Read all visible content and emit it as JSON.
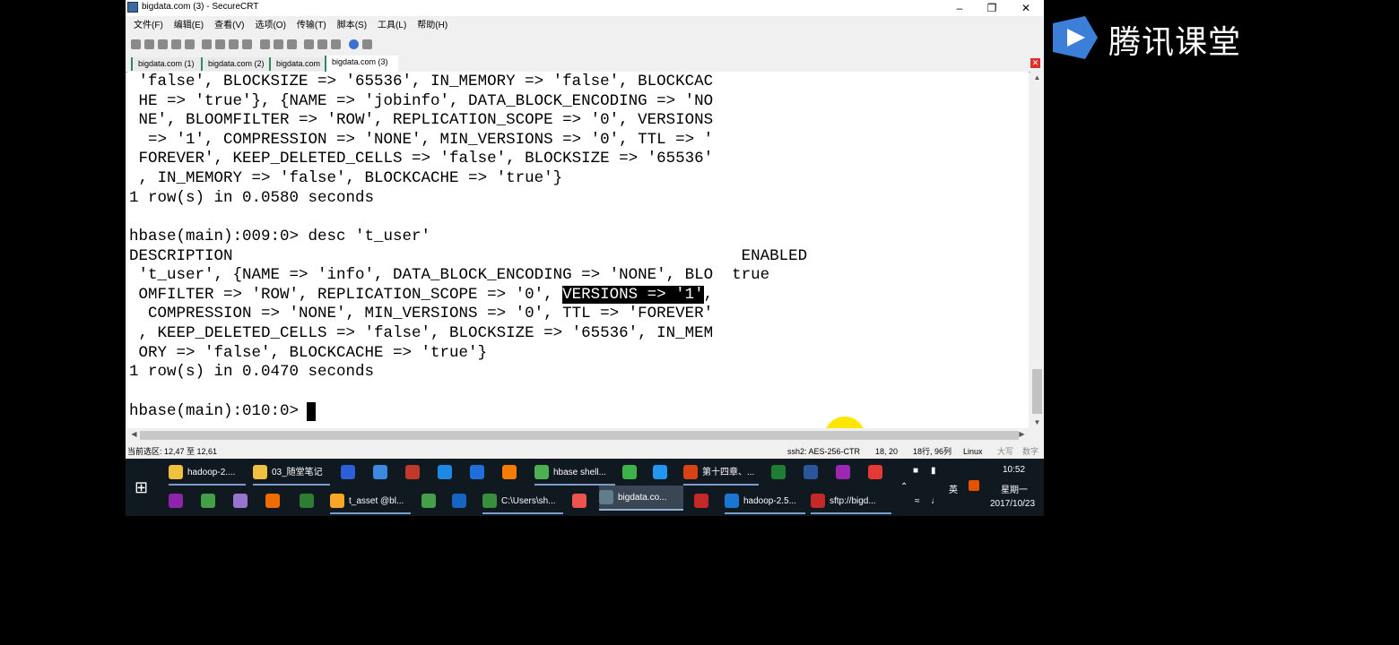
{
  "window": {
    "title": "bigdata.com (3) - SecureCRT"
  },
  "menu": [
    "文件(F)",
    "编辑(E)",
    "查看(V)",
    "选项(O)",
    "传输(T)",
    "脚本(S)",
    "工具(L)",
    "帮助(H)"
  ],
  "tabs": [
    {
      "label": "bigdata.com (1)"
    },
    {
      "label": "bigdata.com (2)"
    },
    {
      "label": "bigdata.com"
    },
    {
      "label": "bigdata.com (3)"
    }
  ],
  "terminal": {
    "lines": [
      " 'false', BLOCKSIZE => '65536', IN_MEMORY => 'false', BLOCKCAC",
      " HE => 'true'}, {NAME => 'jobinfo', DATA_BLOCK_ENCODING => 'NO",
      " NE', BLOOMFILTER => 'ROW', REPLICATION_SCOPE => '0', VERSIONS",
      "  => '1', COMPRESSION => 'NONE', MIN_VERSIONS => '0', TTL => '",
      " FOREVER', KEEP_DELETED_CELLS => 'false', BLOCKSIZE => '65536'",
      " , IN_MEMORY => 'false', BLOCKCACHE => 'true'}",
      "1 row(s) in 0.0580 seconds",
      "",
      "hbase(main):009:0> desc 't_user'",
      "DESCRIPTION                                                      ENABLED",
      " 't_user', {NAME => 'info', DATA_BLOCK_ENCODING => 'NONE', BLO  true",
      " OMFILTER => 'ROW', REPLICATION_SCOPE => '0', ",
      "  COMPRESSION => 'NONE', MIN_VERSIONS => '0', TTL => 'FOREVER'",
      " , KEEP_DELETED_CELLS => 'false', BLOCKSIZE => '65536', IN_MEM",
      " ORY => 'false', BLOCKCACHE => 'true'}",
      "1 row(s) in 0.0470 seconds",
      "",
      "hbase(main):010:0> "
    ],
    "highlight": "VERSIONS => '1'",
    "highlight_suffix": ","
  },
  "status": {
    "selection": "当前选区: 12,47 至 12,61",
    "cipher": "ssh2: AES-256-CTR",
    "position": "18,  20",
    "size": "18行, 96列",
    "os": "Linux",
    "caps": "大写",
    "num": "数字"
  },
  "taskbar": {
    "row1": [
      {
        "label": "hadoop-2....",
        "color": "#f0c040"
      },
      {
        "label": "03_随堂笔记",
        "color": "#f0c040"
      },
      {
        "label": "",
        "color": "#2a5fd8"
      },
      {
        "label": "",
        "color": "#3b8ae0"
      },
      {
        "label": "",
        "color": "#c0392b"
      },
      {
        "label": "",
        "color": "#1e88e5"
      },
      {
        "label": "",
        "color": "#1e6fd9"
      },
      {
        "label": "",
        "color": "#f57c00"
      },
      {
        "label": "hbase shell...",
        "color": "#4caf50"
      },
      {
        "label": "",
        "color": "#3cb44b"
      },
      {
        "label": "",
        "color": "#2196f3"
      },
      {
        "label": "第十四章、...",
        "color": "#d84315"
      },
      {
        "label": "",
        "color": "#1e7e34"
      },
      {
        "label": "",
        "color": "#2b579a"
      },
      {
        "label": "",
        "color": "#9c27b0"
      },
      {
        "label": "",
        "color": "#e53935"
      }
    ],
    "row2": [
      {
        "label": "",
        "color": "#8e24aa"
      },
      {
        "label": "",
        "color": "#43a047"
      },
      {
        "label": "",
        "color": "#9575cd"
      },
      {
        "label": "",
        "color": "#ef6c00"
      },
      {
        "label": "",
        "color": "#2e7d32"
      },
      {
        "label": "t_asset @bl...",
        "color": "#f9a825"
      },
      {
        "label": "",
        "color": "#43a047"
      },
      {
        "label": "",
        "color": "#1565c0"
      },
      {
        "label": "C:\\Users\\sh...",
        "color": "#388e3c"
      },
      {
        "label": "",
        "color": "#ef5350"
      },
      {
        "label": "bigdata.co...",
        "color": "#607d8b"
      },
      {
        "label": "",
        "color": "#c62828"
      },
      {
        "label": "hadoop-2.5...",
        "color": "#1976d2"
      },
      {
        "label": "sftp://bigd...",
        "color": "#c62828"
      }
    ],
    "tray": {
      "ime": "英",
      "time": "10:52",
      "weekday": "星期一",
      "date": "2017/10/23"
    }
  },
  "overlay_logo": "腾讯课堂"
}
